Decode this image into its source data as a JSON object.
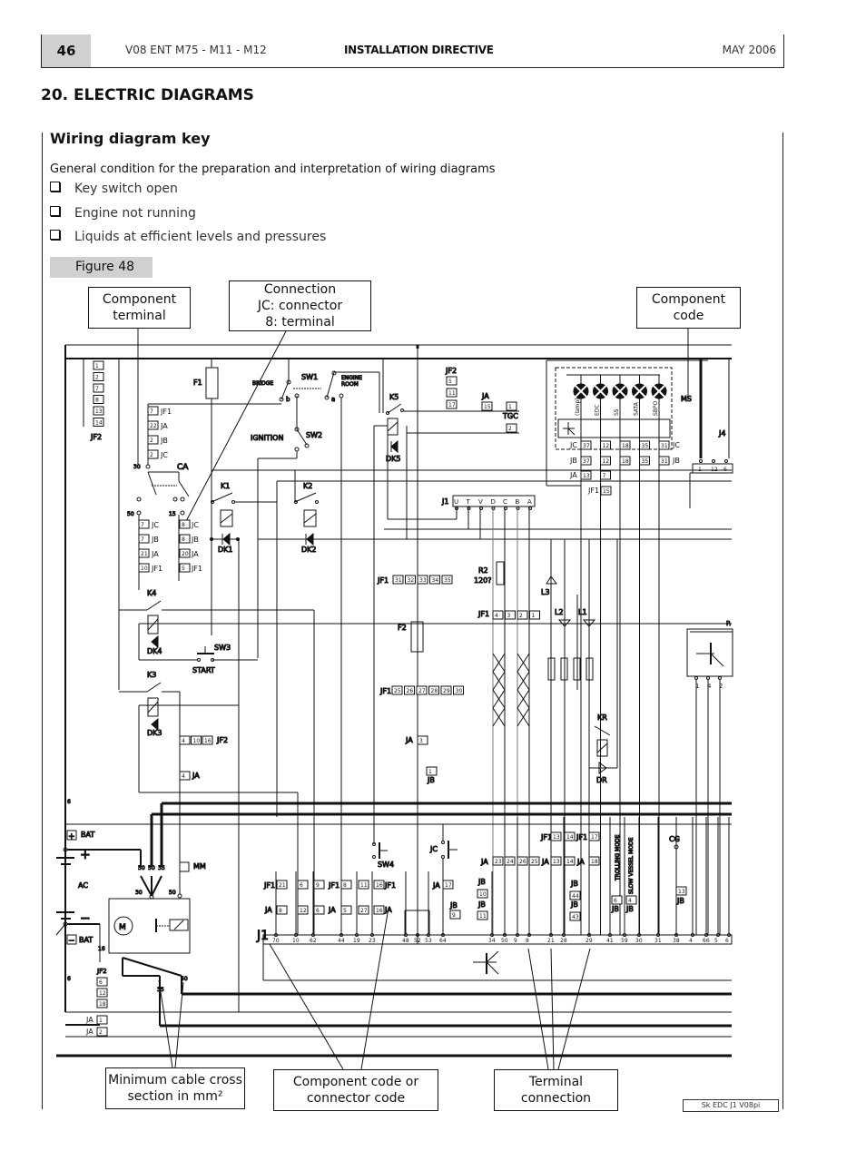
{
  "header": {
    "page_number": "46",
    "model": "V08 ENT M75 - M11 - M12",
    "document": "INSTALLATION DIRECTIVE",
    "date": "MAY 2006"
  },
  "section_title": "20. ELECTRIC DIAGRAMS",
  "key": {
    "title": "Wiring diagram key",
    "intro": "General condition for the preparation and interpretation of wiring diagrams",
    "conditions": [
      "Key switch open",
      "Engine not running",
      "Liquids at efficient levels and pressures"
    ],
    "figure_label": "Figure 48"
  },
  "callouts": {
    "component_terminal": [
      "Component",
      "terminal"
    ],
    "connection": [
      "Connection",
      "JC: connector",
      "8: terminal"
    ],
    "component_code": [
      "Component",
      "code"
    ],
    "min_cable": [
      "Minimum cable cross",
      "section in  mm²"
    ],
    "component_or_connector": [
      "Component code or",
      "connector code"
    ],
    "terminal_connection": [
      "Terminal",
      "connection"
    ]
  },
  "doc_reference": "Sk EDC J1 V08pi",
  "diagram": {
    "jf2_top_terminals": [
      "1",
      "2",
      "7",
      "8",
      "13",
      "14"
    ],
    "jf2_top_label": "JF2",
    "components": {
      "F1": "F1",
      "F2": "F2",
      "SW1": "SW1",
      "SW2": "SW2",
      "SW3": "SW3",
      "SW4": "SW4",
      "K1": "K1",
      "K2": "K2",
      "K3": "K3",
      "K4": "K4",
      "K5": "K5",
      "KR": "KR",
      "DK1": "DK1",
      "DK2": "DK2",
      "DK3": "DK3",
      "DK4": "DK4",
      "DK5": "DK5",
      "DR": "DR",
      "CA": "CA",
      "MM": "MM",
      "AC": "AC",
      "TGC": "TGC",
      "MS": "MS",
      "CG": "CG",
      "R2": "R2",
      "R2_value": "120?",
      "L1": "L1",
      "L2": "L2",
      "L3": "L3",
      "J1": "J1",
      "J4": "J4",
      "P": "P."
    },
    "labels": {
      "bridge": "BRIDGE",
      "engine_room": [
        "ENGINE",
        "ROOM"
      ],
      "ignition": "IGNITION",
      "start": "START",
      "bat_plus": "BAT",
      "bat_minus": "BAT",
      "trolling_mode": "TROLLING MODE",
      "slow_vessel_mode": "SLOW VESSEL MODE",
      "sw1_a": "a",
      "sw1_b": "b"
    },
    "ca_left_stack": [
      [
        "7",
        "JF1"
      ],
      [
        "22",
        "JA"
      ],
      [
        "2",
        "JB"
      ],
      [
        "2",
        "JC"
      ]
    ],
    "ca_terminal_labels": {
      "t30": "30",
      "t50": "50",
      "t15": "15"
    },
    "ca_50_stack": [
      [
        "7",
        "JC"
      ],
      [
        "7",
        "JB"
      ],
      [
        "21",
        "JA"
      ],
      [
        "10",
        "JF1"
      ]
    ],
    "ca_15_stack": [
      [
        "8",
        "JC"
      ],
      [
        "8",
        "JB"
      ],
      [
        "20",
        "JA"
      ],
      [
        "5",
        "JF1"
      ]
    ],
    "jf2_k5": [
      "5",
      "11",
      "17"
    ],
    "ja_k5": "15",
    "tgc_terminals": [
      "1",
      "2"
    ],
    "j1_pins": [
      "U",
      "T",
      "V",
      "D",
      "C",
      "B",
      "A"
    ],
    "ms_lamps": [
      "(lamp)",
      "EDC",
      "SS",
      "SATA",
      "SBPO"
    ],
    "ms_jc": [
      "37",
      "12",
      "18",
      "35",
      "31"
    ],
    "ms_jb": [
      "37",
      "12",
      "18",
      "35",
      "31"
    ],
    "ms_ja": [
      "13",
      "7"
    ],
    "ms_jf1": "15",
    "j4_pins": [
      "1",
      "12",
      "6"
    ],
    "jf1_top_bank": [
      "31",
      "32",
      "33",
      "34",
      "35"
    ],
    "jf1_bottom_bank": [
      "25",
      "26",
      "27",
      "28",
      "29",
      "30"
    ],
    "jf1_can": [
      "4",
      "3",
      "2",
      "1"
    ],
    "ja_3": "3",
    "jb_1": "1",
    "k3_jf2": [
      "4",
      "10",
      "16"
    ],
    "k3_ja": "4",
    "p_pins": [
      "1",
      "4",
      "2"
    ],
    "starter_wires": [
      "50",
      "50",
      "35"
    ],
    "starter_terms": [
      "30",
      "50"
    ],
    "ground_wire": "16",
    "jf2_bottom": [
      "6",
      "12",
      "18"
    ],
    "ja_bottom": [
      "1",
      "2"
    ],
    "bottom_wire_sizes": [
      "35",
      "50"
    ],
    "left_wire_size": "6",
    "lower_jf1": [
      [
        "21"
      ],
      [
        "6"
      ],
      [
        "9"
      ],
      [
        "8"
      ],
      [
        "11"
      ],
      [
        "16"
      ]
    ],
    "lower_ja": [
      [
        "8"
      ],
      [
        "12"
      ],
      [
        "6"
      ],
      [
        "5"
      ],
      [
        "27"
      ],
      [
        "16"
      ]
    ],
    "ja_17": "17",
    "jb_9": "9",
    "jb_10": "10",
    "jb_11": "11",
    "ja_mid": [
      "23",
      "24",
      "26",
      "25",
      "13",
      "14",
      "18"
    ],
    "jf1_mid": [
      "13",
      "14",
      "17"
    ],
    "jb_44": "44",
    "jb_43": "43",
    "jb_6": "6",
    "jb_4": "4",
    "jb_13": "13",
    "j1_bottom_pins": [
      "70",
      "10",
      "62",
      "44",
      "19",
      "23",
      "48",
      "52",
      "53",
      "64",
      "34",
      "50",
      "9",
      "8",
      "21",
      "28",
      "29",
      "41",
      "59",
      "30",
      "31",
      "38",
      "4",
      "66",
      "5",
      "6"
    ]
  }
}
